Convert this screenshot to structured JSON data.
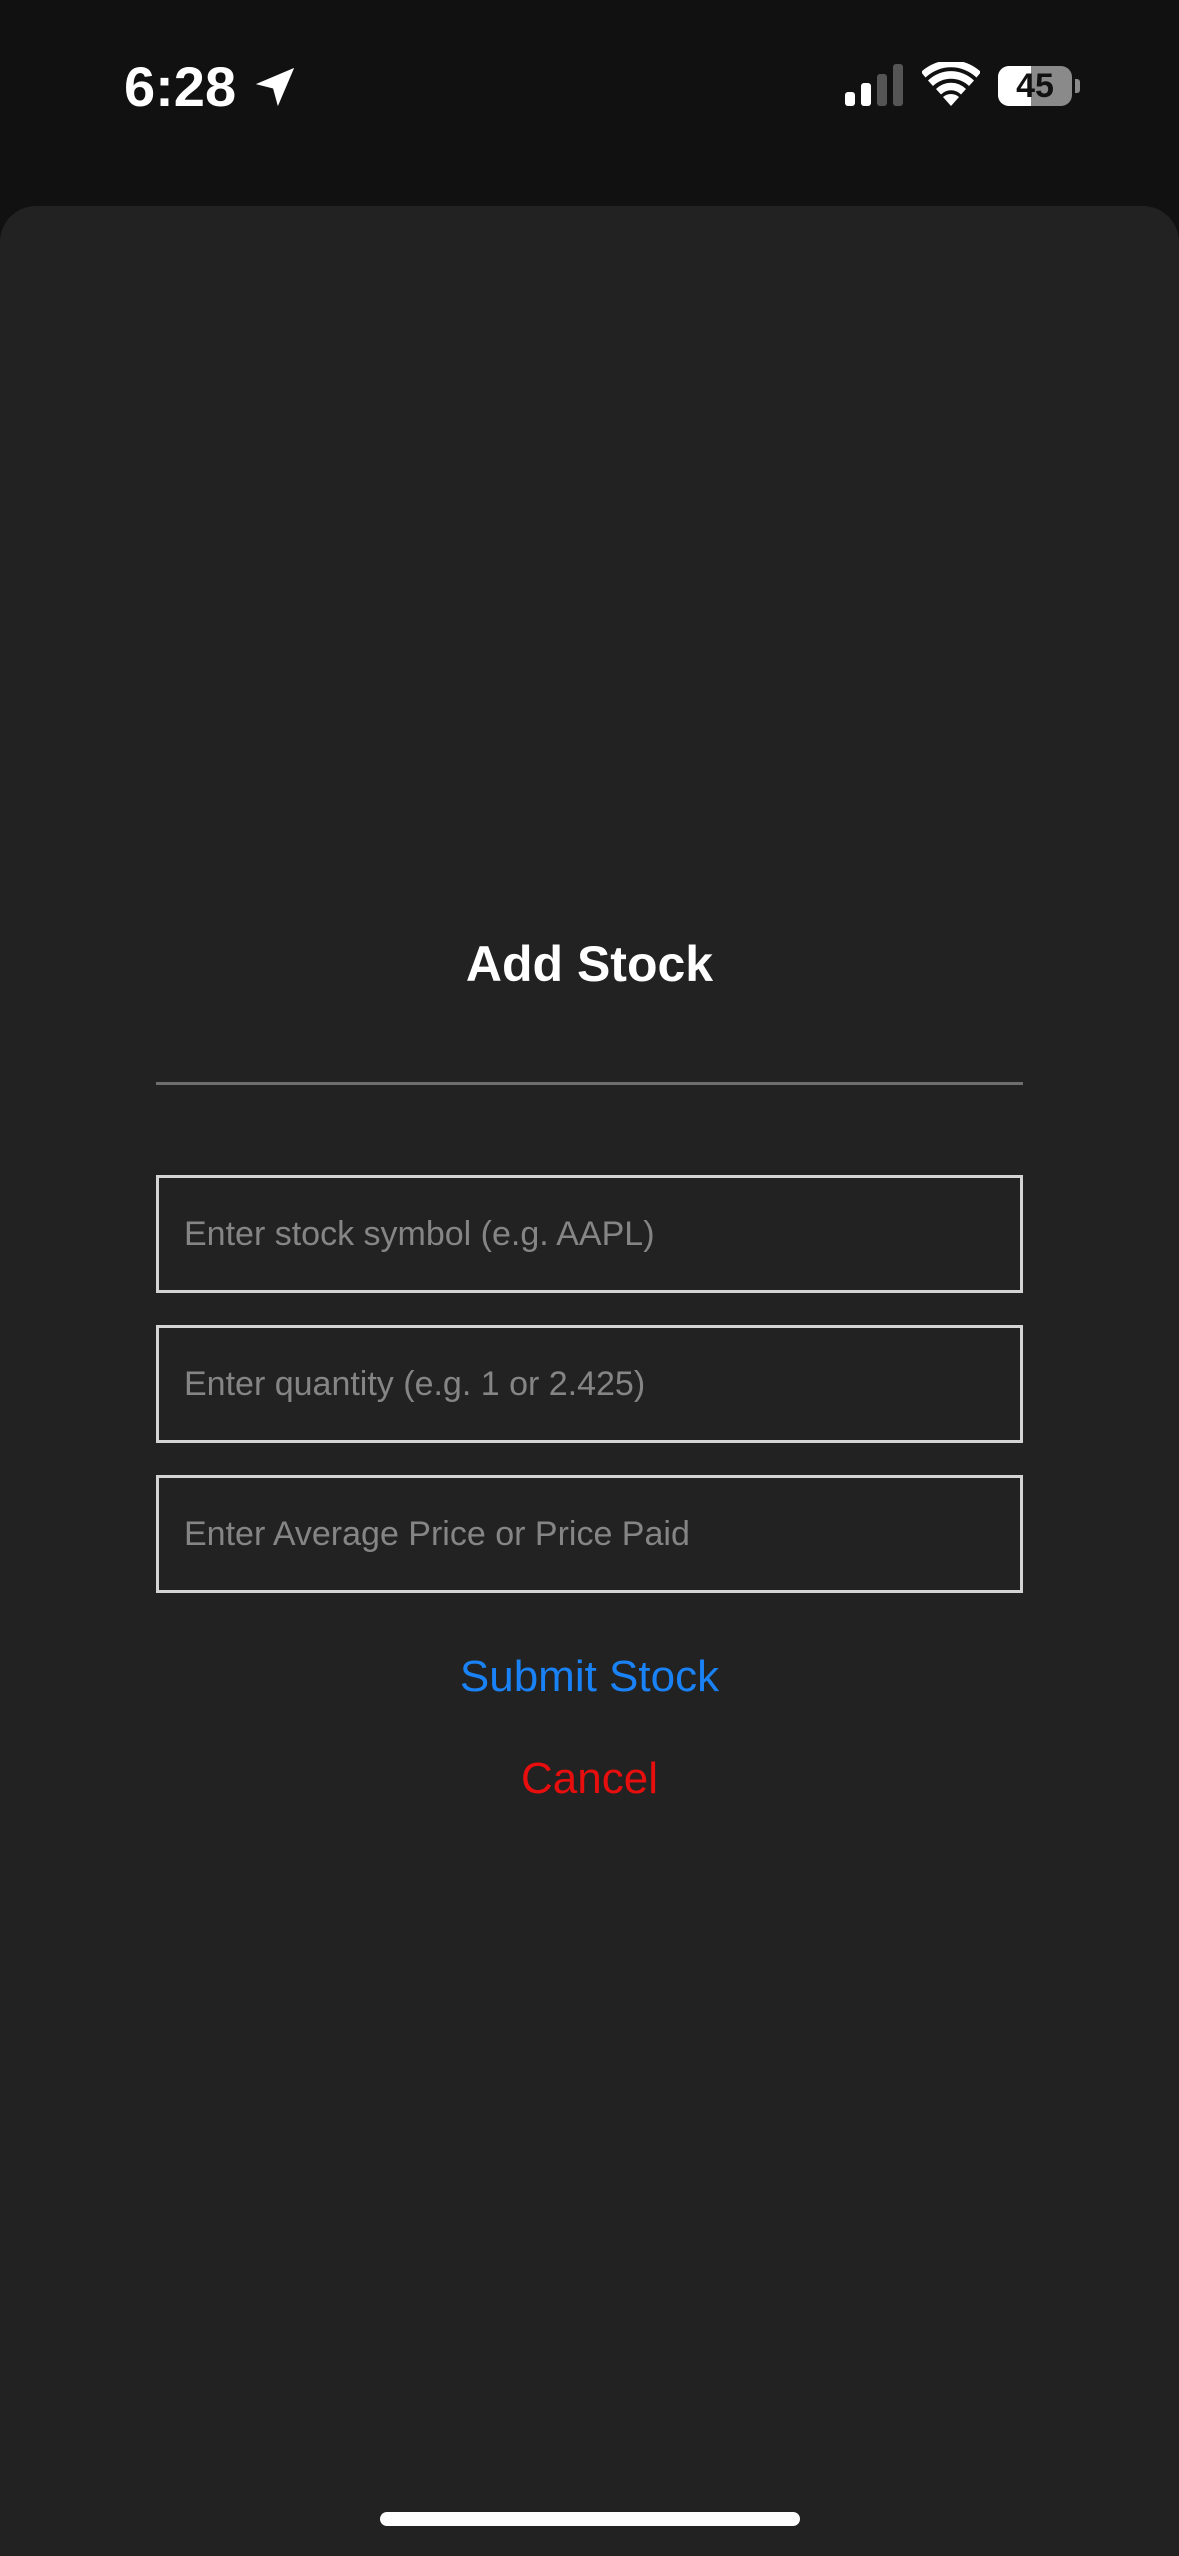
{
  "status_bar": {
    "time": "6:28",
    "battery_level": "45",
    "battery_fraction": 0.45,
    "icons": [
      "location-arrow-icon",
      "cellular-signal-icon",
      "wifi-icon",
      "battery-icon"
    ]
  },
  "sheet": {
    "title": "Add Stock",
    "fields": {
      "symbol": {
        "value": "",
        "placeholder": "Enter stock symbol (e.g. AAPL)"
      },
      "quantity": {
        "value": "",
        "placeholder": "Enter quantity (e.g. 1 or 2.425)"
      },
      "price": {
        "value": "",
        "placeholder": "Enter Average Price or Price Paid"
      }
    },
    "submit_label": "Submit Stock",
    "cancel_label": "Cancel"
  },
  "colors": {
    "background": "#111111",
    "sheet": "#222222",
    "submit": "#1a82f7",
    "cancel": "#e80e0e",
    "field_border": "#d4d4d4",
    "placeholder": "#858585"
  }
}
